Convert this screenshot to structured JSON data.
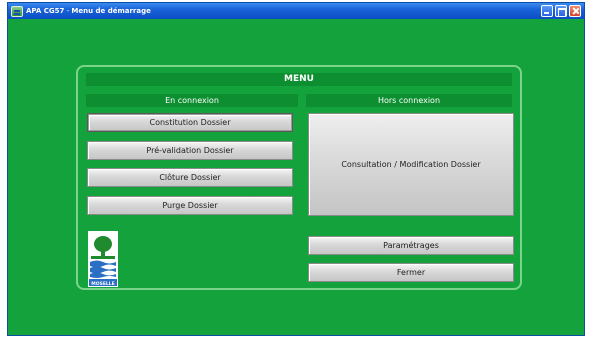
{
  "window": {
    "app_name": "APA CG57",
    "separator": " - ",
    "subtitle": "Menu de démarrage"
  },
  "menu": {
    "title": "MENU",
    "online": {
      "label": "En connexion",
      "buttons": [
        "Constitution Dossier",
        "Pré-validation Dossier",
        "Clôture Dossier",
        "Purge Dossier"
      ]
    },
    "offline": {
      "label": "Hors connexion",
      "button": "Consultation / Modification Dossier"
    },
    "settings_button": "Paramétrages",
    "close_button": "Fermer"
  },
  "logo": {
    "text": "MOSELLE"
  },
  "colors": {
    "background": "#13a23c",
    "header_band": "#0d8f31",
    "panel_border": "#7bd489",
    "titlebar": "#1a62d8"
  }
}
